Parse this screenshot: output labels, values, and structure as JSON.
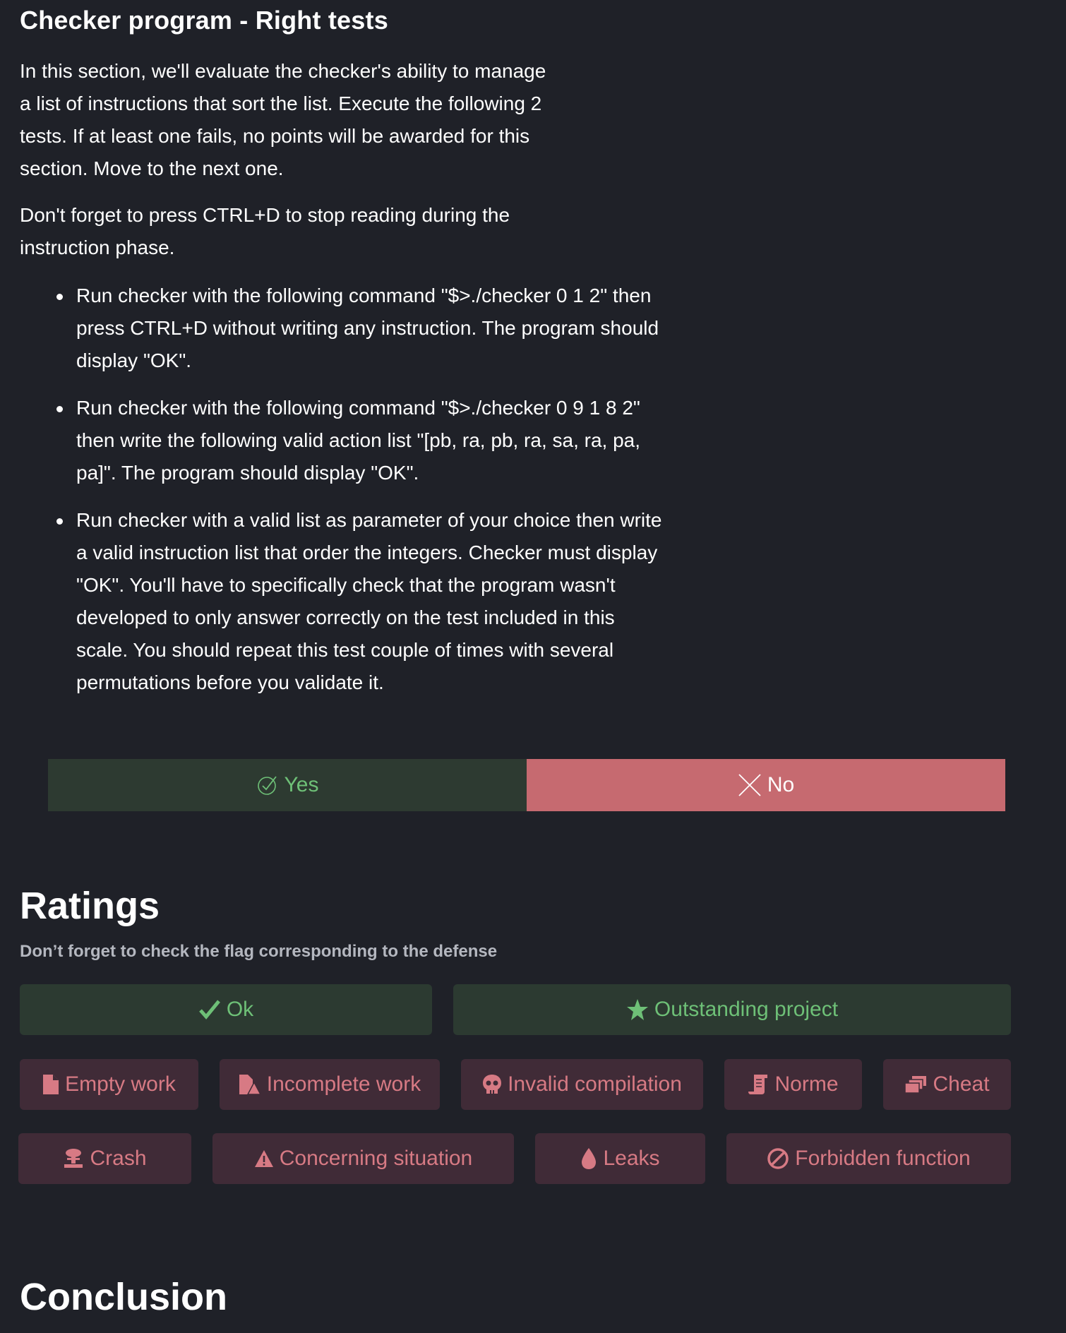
{
  "section": {
    "title": "Checker program - Right tests",
    "description": "In this section, we'll evaluate the checker's ability to manage a list of instructions that sort the list. Execute the following 2 tests. If at least one fails, no points will be awarded for this section. Move to the next one.",
    "note": "Don't forget to press CTRL+D to stop reading during the instruction phase.",
    "bullets": [
      "Run checker with the following command \"$>./checker 0 1 2\" then press CTRL+D without writing any instruction. The program should display \"OK\".",
      "Run checker with the following command \"$>./checker 0 9 1 8 2\" then write the following valid action list \"[pb, ra, pb, ra, sa, ra, pa, pa]\". The program should display \"OK\".",
      "Run checker with a valid list as parameter of your choice then write a valid instruction list that order the integers. Checker must display \"OK\". You'll have to specifically check that the program wasn't developed to only answer correctly on the test included in this scale. You should repeat this test couple of times with several permutations before you validate it."
    ],
    "yes_label": "Yes",
    "no_label": "No"
  },
  "ratings": {
    "title": "Ratings",
    "subtitle": "Don’t forget to check the flag corresponding to the defense",
    "flags": [
      {
        "label": "Ok",
        "icon": "check-icon"
      },
      {
        "label": "Outstanding project",
        "icon": "star-icon"
      },
      {
        "label": "Empty work",
        "icon": "file-icon"
      },
      {
        "label": "Incomplete work",
        "icon": "file-warning-icon"
      },
      {
        "label": "Invalid compilation",
        "icon": "skull-icon"
      },
      {
        "label": "Norme",
        "icon": "scroll-icon"
      },
      {
        "label": "Cheat",
        "icon": "copy-icon"
      },
      {
        "label": "Crash",
        "icon": "explosion-icon"
      },
      {
        "label": "Concerning situation",
        "icon": "warning-icon"
      },
      {
        "label": "Leaks",
        "icon": "drop-icon"
      },
      {
        "label": "Forbidden function",
        "icon": "forbidden-icon"
      }
    ]
  },
  "conclusion": {
    "title": "Conclusion"
  },
  "colors": {
    "background": "#1f2128",
    "good_bg": "#2c3a31",
    "good_text": "#6ec077",
    "bad_bg": "#402b37",
    "bad_text": "#d77a84",
    "no_bg": "#c66a70"
  }
}
